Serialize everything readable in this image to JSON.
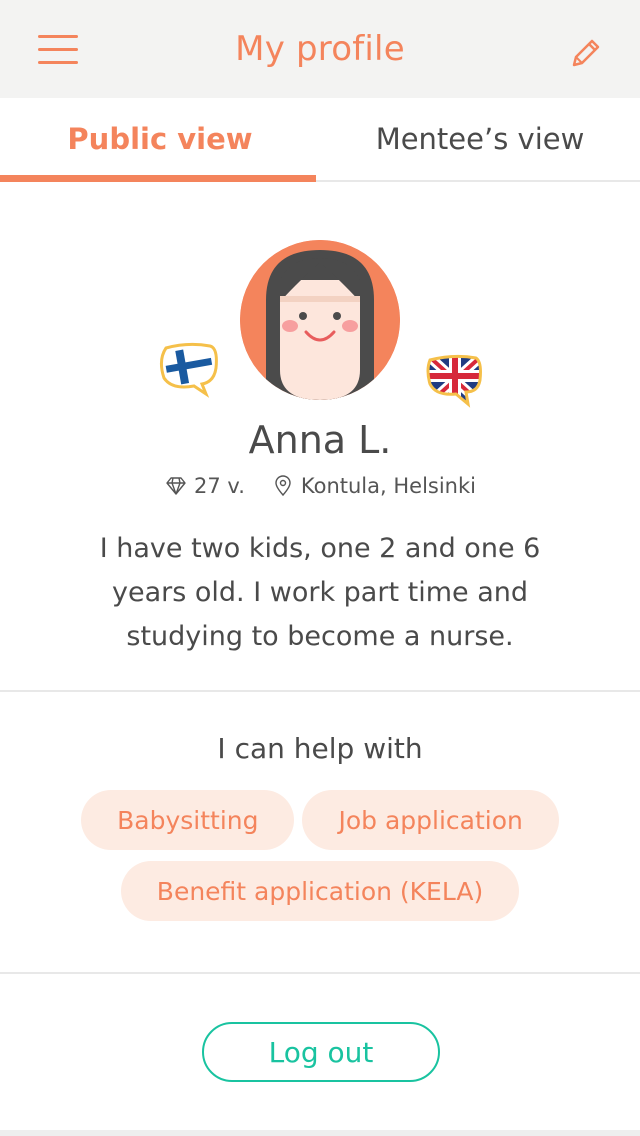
{
  "header": {
    "title": "My profile",
    "menu_icon": "hamburger-menu-icon",
    "edit_icon": "pencil-icon"
  },
  "tabs": [
    {
      "label": "Public view",
      "active": true
    },
    {
      "label": "Mentee’s view",
      "active": false
    }
  ],
  "profile": {
    "name": "Anna L.",
    "age": "27 v.",
    "location": "Kontula, Helsinki",
    "bio": "I have two kids, one 2 and one 6 years old. I work part time and studying to become a nurse.",
    "languages": [
      "finland-flag-icon",
      "uk-flag-icon"
    ]
  },
  "help": {
    "title": "I can help with",
    "tags": [
      "Babysitting",
      "Job application",
      "Benefit application (KELA)"
    ]
  },
  "actions": {
    "logout_label": "Log out"
  },
  "colors": {
    "accent": "#f4845c",
    "chip_bg": "#fdebe2",
    "logout": "#19c3a0",
    "header_bg": "#f3f3f2",
    "text": "#4a4a4a"
  }
}
